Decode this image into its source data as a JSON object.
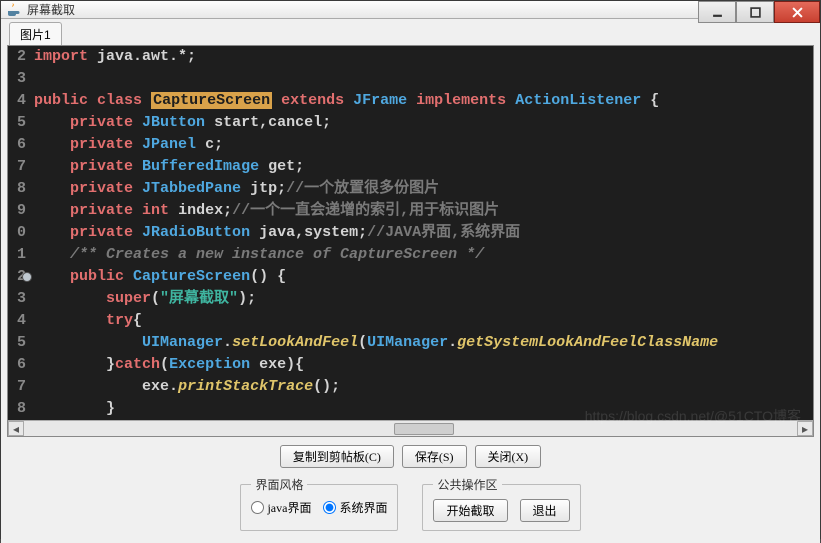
{
  "window": {
    "title": "屏幕截取"
  },
  "tab": {
    "label": "图片1"
  },
  "lines": [
    "2",
    "3",
    "4",
    "5",
    "6",
    "7",
    "8",
    "9",
    "0",
    "1",
    "2",
    "3",
    "4",
    "5",
    "6",
    "7",
    "8"
  ],
  "led_line_index": 10,
  "code": {
    "l1": "import java.awt.*;",
    "l2": "",
    "kw_public": "public",
    "kw_class": "class",
    "classname": "CaptureScreen",
    "kw_extends": "extends",
    "JFrame": "JFrame",
    "kw_implements": "implements",
    "ActionListener": "ActionListener",
    "brace_open": "{",
    "kw_private": "private",
    "JButton": "JButton",
    "start_cancel": "start,cancel;",
    "JPanel": "JPanel",
    "c_var": "c;",
    "BufferedImage": "BufferedImage",
    "get_var": "get;",
    "JTabbedPane": "JTabbedPane",
    "jtp_var": "jtp;",
    "cmt_jtp": "//一个放置很多份图片",
    "kw_int": "int",
    "index_var": "index;",
    "cmt_index": "//一个一直会递增的索引,用于标识图片",
    "JRadioButton": "JRadioButton",
    "java_system_var": "java,system;",
    "cmt_javasys": "//JAVA界面,系统界面",
    "cmt_doc": "/** Creates a new instance of CaptureScreen */",
    "ctor_name": "CaptureScreen",
    "paren_empty": "()",
    "kw_super": "super",
    "super_arg": "\"屏幕截取\"",
    "kw_try": "try",
    "UIManager": "UIManager",
    "setLookAndFeel": "setLookAndFeel",
    "getSystemLookAndFeelClassName": "getSystemLookAndFeelClassName",
    "kw_catch": "catch",
    "Exception": "Exception",
    "exe": "exe",
    "printStackTrace": "printStackTrace"
  },
  "buttons": {
    "copy": "复制到剪帖板(C)",
    "save": "保存(S)",
    "close": "关闭(X)"
  },
  "group_style": {
    "legend": "界面风格",
    "java": "java界面",
    "system": "系统界面",
    "selected": "system"
  },
  "group_ops": {
    "legend": "公共操作区",
    "start": "开始截取",
    "exit": "退出"
  },
  "watermark": "https://blog.csdn.net/@51CTO博客"
}
